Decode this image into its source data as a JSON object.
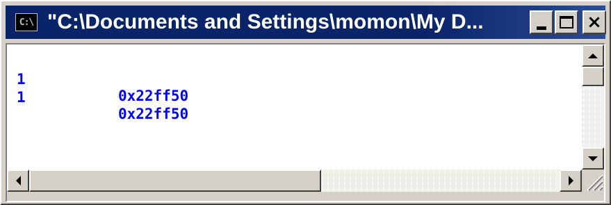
{
  "window": {
    "title": "\"C:\\Documents and Settings\\momon\\My D...",
    "icon_label": "C:\\",
    "icon_name": "console-app-icon"
  },
  "caption_buttons": {
    "minimize_icon": "minimize-icon",
    "maximize_icon": "maximize-icon",
    "close_label": "×"
  },
  "console": {
    "lines": [
      {
        "col1": "1",
        "col2": "0x22ff50"
      },
      {
        "col1": "1",
        "col2": "0x22ff50"
      }
    ],
    "text_color": "#0000ff",
    "background": "#ffffff"
  },
  "colors": {
    "titlebar": "#0a246a",
    "chrome": "#d4d0c8"
  }
}
